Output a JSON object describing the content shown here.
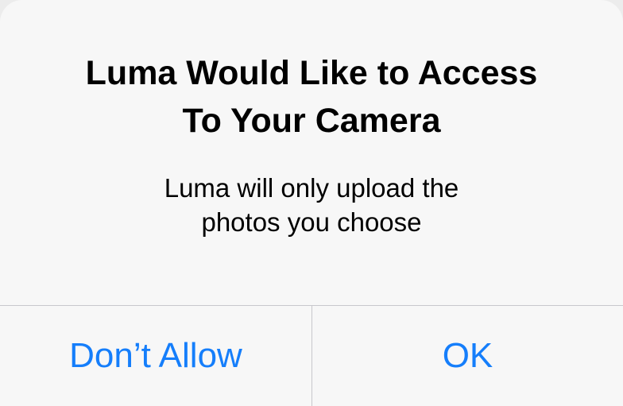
{
  "dialog": {
    "title_line1": "Luma Would Like to Access",
    "title_line2": "To Your Camera",
    "message_line1": "Luma will only upload the",
    "message_line2": "photos you choose"
  },
  "buttons": {
    "deny_label": "Don’t Allow",
    "confirm_label": "OK"
  },
  "colors": {
    "accent": "#157efb",
    "background": "#f7f7f7",
    "separator": "#c8c7cc",
    "text": "#000000"
  }
}
